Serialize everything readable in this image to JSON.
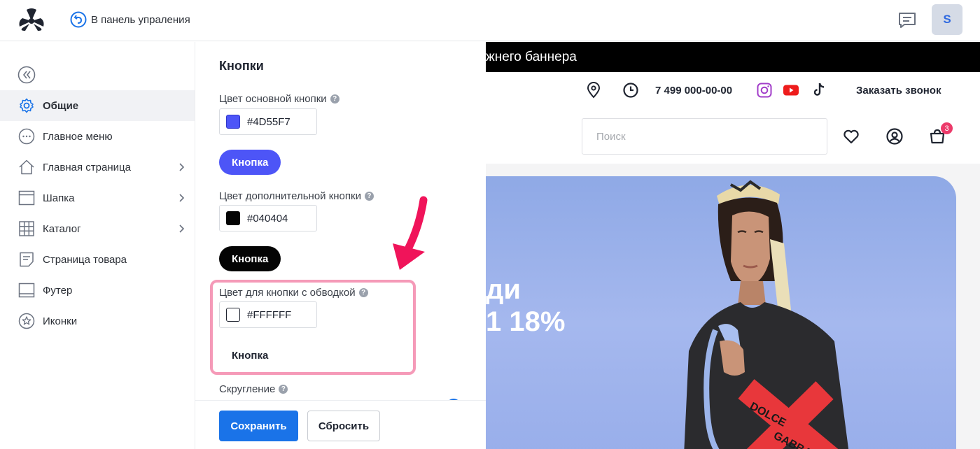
{
  "topbar": {
    "back_label": "В панель упраления",
    "avatar_letter": "S"
  },
  "sidebar": {
    "items": [
      {
        "label": "Общие",
        "icon": "gear-icon",
        "active": true,
        "has_submenu": false
      },
      {
        "label": "Главное меню",
        "icon": "dots-circle-icon",
        "active": false,
        "has_submenu": false
      },
      {
        "label": "Главная страница",
        "icon": "home-icon",
        "active": false,
        "has_submenu": true
      },
      {
        "label": "Шапка",
        "icon": "header-layout-icon",
        "active": false,
        "has_submenu": true
      },
      {
        "label": "Каталог",
        "icon": "grid-icon",
        "active": false,
        "has_submenu": true
      },
      {
        "label": "Страница товара",
        "icon": "document-icon",
        "active": false,
        "has_submenu": false
      },
      {
        "label": "Футер",
        "icon": "footer-layout-icon",
        "active": false,
        "has_submenu": false
      },
      {
        "label": "Иконки",
        "icon": "star-circle-icon",
        "active": false,
        "has_submenu": false
      }
    ]
  },
  "panel": {
    "title": "Кнопки",
    "primary": {
      "label": "Цвет основной кнопки",
      "value": "#4D55F7",
      "button_label": "Кнопка"
    },
    "secondary": {
      "label": "Цвет дополнительной кнопки",
      "value": "#040404",
      "button_label": "Кнопка"
    },
    "outline": {
      "label": "Цвет для кнопки с обводкой",
      "value": "#FFFFFF",
      "button_label": "Кнопка"
    },
    "rounding_label": "Скругление",
    "help_glyph": "?",
    "save_label": "Сохранить",
    "reset_label": "Сбросить"
  },
  "site": {
    "promo_text": "жнего баннера",
    "phone": "7 499 000-00-00",
    "callback": "Заказать звонок",
    "search_placeholder": "Поиск",
    "cart_count": "3",
    "banner_line1": "ди",
    "banner_line2": "1 18%"
  },
  "colors": {
    "accent": "#1a73e8",
    "primary_button": "#4D55F7",
    "secondary_button": "#040404",
    "highlight": "#f59ab8",
    "annotation_arrow": "#f0145a"
  }
}
